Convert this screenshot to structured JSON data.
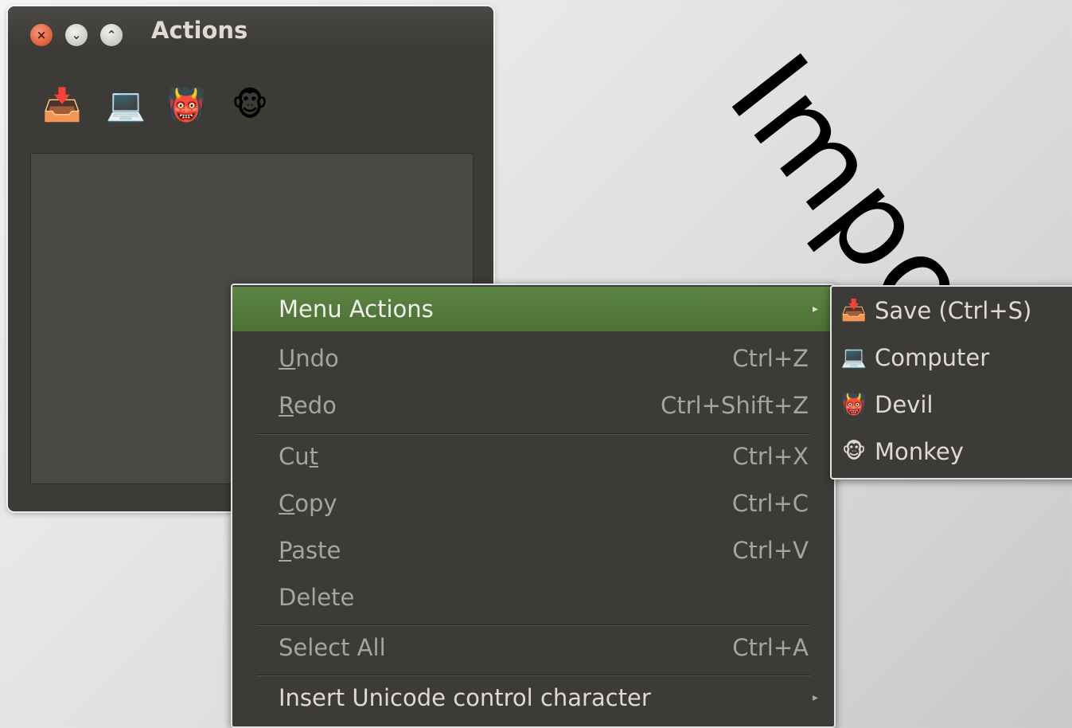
{
  "background_text": "Import",
  "window": {
    "title": "Actions",
    "buttons": {
      "close": "×",
      "minimize": "⌄",
      "maximize": "⌃"
    },
    "toolbar": [
      {
        "icon": "save-icon",
        "glyph": "📥"
      },
      {
        "icon": "computer-icon",
        "glyph": "💻"
      },
      {
        "icon": "devil-icon",
        "glyph": "👹"
      },
      {
        "icon": "monkey-icon",
        "glyph": "🐵"
      }
    ]
  },
  "context_menu": {
    "items": [
      {
        "label": "Menu Actions",
        "accel": "",
        "submenu": true,
        "state": "active"
      },
      {
        "label": "Undo",
        "mnemonic": "U",
        "accel": "Ctrl+Z"
      },
      {
        "label": "Redo",
        "mnemonic": "R",
        "accel": "Ctrl+Shift+Z"
      },
      {
        "label": "Cut",
        "mnemonic": "t",
        "accel": "Ctrl+X"
      },
      {
        "label": "Copy",
        "mnemonic": "C",
        "accel": "Ctrl+C"
      },
      {
        "label": "Paste",
        "mnemonic": "P",
        "accel": "Ctrl+V"
      },
      {
        "label": "Delete",
        "accel": ""
      },
      {
        "label": "Select All",
        "accel": "Ctrl+A"
      },
      {
        "label": "Insert Unicode control character",
        "accel": "",
        "submenu": true,
        "state": "enabled"
      }
    ],
    "arrow_glyph": "▸"
  },
  "submenu": {
    "items": [
      {
        "label": "Save (Ctrl+S)",
        "icon": "save-icon",
        "glyph": "📥"
      },
      {
        "label": "Computer",
        "icon": "computer-icon",
        "glyph": "💻"
      },
      {
        "label": "Devil",
        "icon": "devil-icon",
        "glyph": "👹"
      },
      {
        "label": "Monkey",
        "icon": "monkey-icon",
        "glyph": "🐵"
      }
    ]
  },
  "colors": {
    "menu_bg": "#3c3b37",
    "highlight": "#5c8443",
    "text_enabled": "#dfdbd2",
    "text_disabled": "#a6a49f"
  }
}
